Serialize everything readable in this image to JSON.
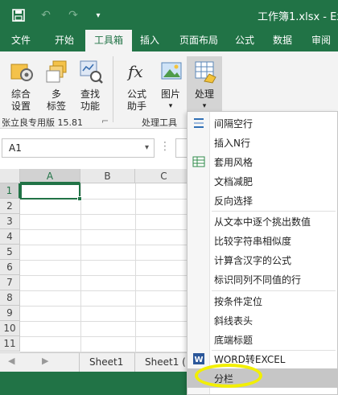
{
  "window": {
    "title": "工作簿1.xlsx - Ex"
  },
  "quick_access": [
    {
      "icon": "save-icon",
      "glyph": "💾"
    },
    {
      "icon": "undo-icon",
      "glyph": "↶"
    },
    {
      "icon": "redo-icon",
      "glyph": "↷"
    },
    {
      "icon": "customize-icon",
      "glyph": "▾"
    }
  ],
  "tabs": [
    "文件",
    "开始",
    "工具箱",
    "插入",
    "页面布局",
    "公式",
    "数据",
    "审阅"
  ],
  "active_tab": "工具箱",
  "ribbon": {
    "buttons": [
      {
        "line1": "综合",
        "line2": "设置",
        "icon": "settings-icon"
      },
      {
        "line1": "多",
        "line2": "标签",
        "icon": "multi-tab-icon"
      },
      {
        "line1": "查找",
        "line2": "功能",
        "icon": "find-icon"
      },
      {
        "line1": "公式",
        "line2": "助手",
        "icon": "fx-icon"
      },
      {
        "line1": "图片",
        "line2": "▾",
        "icon": "picture-icon"
      },
      {
        "line1": "处理",
        "line2": "▾",
        "icon": "process-icon"
      }
    ],
    "groups": [
      {
        "label": "张立良专用版 15.81",
        "launcher": "⌐"
      },
      {
        "label": "处理工具",
        "launcher": ""
      }
    ]
  },
  "formula_bar": {
    "name_box": "A1",
    "name_box_arrow": "▾",
    "more": "⋮",
    "formula": ""
  },
  "columns": [
    "A",
    "B",
    "C"
  ],
  "rows": [
    "1",
    "2",
    "3",
    "4",
    "5",
    "6",
    "7",
    "8",
    "9",
    "10",
    "11"
  ],
  "sheets": {
    "nav_prev": "◀",
    "nav_next": "▶",
    "tabs": [
      "Sheet1",
      "Sheet1 ("
    ]
  },
  "menu": {
    "items": [
      {
        "label": "间隔空行",
        "icon": "interval-row-icon"
      },
      {
        "label": "插入N行",
        "icon": ""
      },
      {
        "label": "套用风格",
        "icon": "style-icon"
      },
      {
        "label": "文档减肥",
        "icon": ""
      },
      {
        "label": "反向选择",
        "icon": ""
      },
      {
        "label": "从文本中逐个挑出数值",
        "icon": ""
      },
      {
        "label": "比较字符串相似度",
        "icon": ""
      },
      {
        "label": "计算含汉字的公式",
        "icon": ""
      },
      {
        "label": "标识同列不同值的行",
        "icon": ""
      },
      {
        "label": "按条件定位",
        "icon": ""
      },
      {
        "label": "斜线表头",
        "icon": ""
      },
      {
        "label": "底端标题",
        "icon": ""
      },
      {
        "label": "WORD转EXCEL",
        "icon": "word-icon"
      },
      {
        "label": "分栏",
        "icon": ""
      }
    ],
    "highlighted": "分栏"
  },
  "colors": {
    "excel_green": "#217346",
    "highlight_marker": "#f2ef00"
  }
}
